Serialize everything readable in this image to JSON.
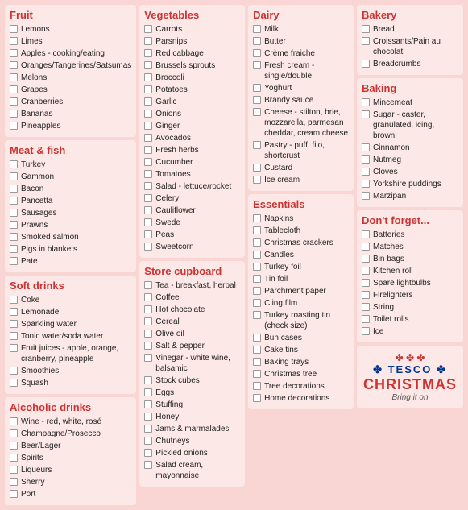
{
  "sections": [
    {
      "id": "fruit",
      "title": "Fruit",
      "items": [
        "Lemons",
        "Limes",
        "Apples - cooking/eating",
        "Oranges/Tangerines/Satsumas",
        "Melons",
        "Grapes",
        "Cranberries",
        "Bananas",
        "Pineapples"
      ]
    },
    {
      "id": "vegetables",
      "title": "Vegetables",
      "items": [
        "Carrots",
        "Parsnips",
        "Red cabbage",
        "Brussels sprouts",
        "Broccoli",
        "Potatoes",
        "Garlic",
        "Onions",
        "Ginger",
        "Avocados",
        "Fresh herbs",
        "Cucumber",
        "Tomatoes",
        "Salad - lettuce/rocket",
        "Celery",
        "Cauliflower",
        "Swede",
        "Peas",
        "Sweetcorn"
      ]
    },
    {
      "id": "dairy",
      "title": "Dairy",
      "items": [
        "Milk",
        "Butter",
        "Crème fraiche",
        "Fresh cream - single/double",
        "Yoghurt",
        "Brandy sauce",
        "Cheese - stilton, brie, mozzarella, parmesan cheddar, cream cheese",
        "Pastry - puff, filo, shortcrust",
        "Custard",
        "Ice cream"
      ]
    },
    {
      "id": "bakery",
      "title": "Bakery",
      "items": [
        "Bread",
        "Croissants/Pain au chocolat",
        "Breadcrumbs"
      ]
    },
    {
      "id": "meat",
      "title": "Meat & fish",
      "items": [
        "Turkey",
        "Gammon",
        "Bacon",
        "Pancetta",
        "Sausages",
        "Prawns",
        "Smoked salmon",
        "Pigs in blankets",
        "Pate"
      ]
    },
    {
      "id": "store",
      "title": "Store cupboard",
      "items": [
        "Tea - breakfast, herbal",
        "Coffee",
        "Hot chocolate",
        "Cereal",
        "Olive oil",
        "Salt & pepper",
        "Vinegar - white wine, balsamic",
        "Stock cubes",
        "Eggs",
        "Stuffing",
        "Honey",
        "Jams & marmalades",
        "Chutneys",
        "Pickled onions",
        "Salad cream, mayonnaise"
      ]
    },
    {
      "id": "essentials",
      "title": "Essentials",
      "items": [
        "Napkins",
        "Tablecloth",
        "Christmas crackers",
        "Candles",
        "Turkey foil",
        "Tin foil",
        "Parchment paper",
        "Cling film",
        "Turkey roasting tin (check size)",
        "Bun cases",
        "Cake tins",
        "Baking trays",
        "Christmas tree",
        "Tree decorations",
        "Home decorations"
      ]
    },
    {
      "id": "baking",
      "title": "Baking",
      "items": [
        "Mincemeat",
        "Sugar - caster, granulated, icing, brown",
        "Cinnamon",
        "Nutmeg",
        "Cloves",
        "Yorkshire puddings",
        "Marzipan"
      ]
    },
    {
      "id": "softdrinks",
      "title": "Soft drinks",
      "items": [
        "Coke",
        "Lemonade",
        "Sparkling water",
        "Tonic water/soda water",
        "Fruit juices - apple, orange, cranberry, pineapple",
        "Smoothies",
        "Squash"
      ]
    },
    {
      "id": "dontforget",
      "title": "Don't forget...",
      "items": [
        "Batteries",
        "Matches",
        "Bin bags",
        "Kitchen roll",
        "Spare lightbulbs",
        "Firelighters",
        "String",
        "Toilet rolls",
        "Ice"
      ]
    },
    {
      "id": "alcoholic",
      "title": "Alcoholic drinks",
      "items": [
        "Wine - red, white, rosé",
        "Champagne/Prosecco",
        "Beer/Lager",
        "Spirits",
        "Liqueurs",
        "Sherry",
        "Port"
      ]
    }
  ],
  "tesco": {
    "brand": "✤ TESCO ✤",
    "christmas": "CHRISTMAS",
    "tagline": "Bring it on"
  }
}
